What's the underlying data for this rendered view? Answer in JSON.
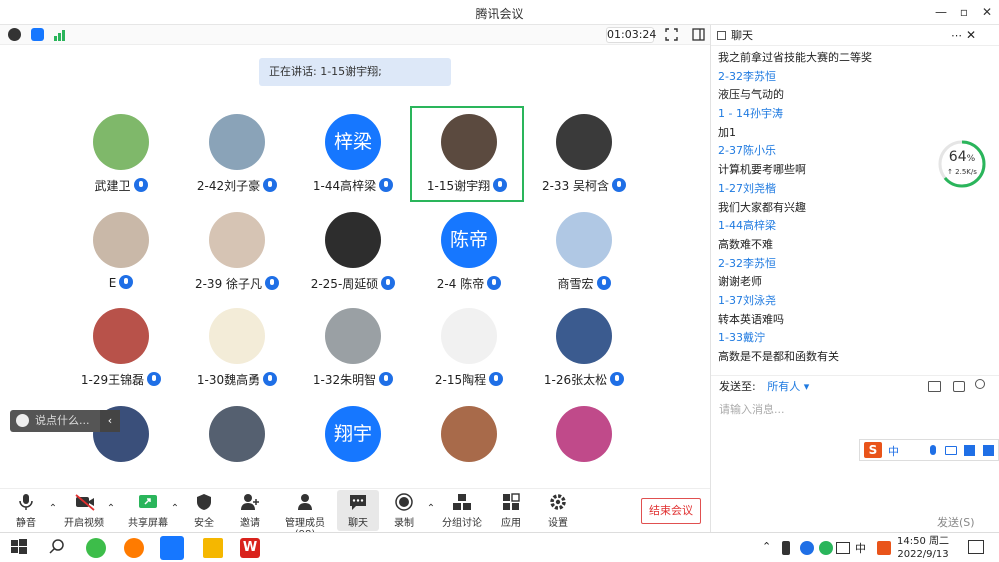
{
  "window": {
    "title": "腾讯会议"
  },
  "topbar": {
    "timer": "01:03:24"
  },
  "main": {
    "speaking": "正在讲话: 1-15谢宇翔;"
  },
  "participants": [
    {
      "name": "武建卫",
      "avatar_text": ""
    },
    {
      "name": "2-42刘子豪",
      "avatar_text": ""
    },
    {
      "name": "1-44高梓梁",
      "avatar_text": "梓梁"
    },
    {
      "name": "1-15谢宇翔",
      "avatar_text": ""
    },
    {
      "name": "2-33 吴柯含",
      "avatar_text": ""
    },
    {
      "name": "E",
      "avatar_text": ""
    },
    {
      "name": "2-39 徐子凡",
      "avatar_text": ""
    },
    {
      "name": "2-25-周延硕",
      "avatar_text": ""
    },
    {
      "name": "2-4 陈帝",
      "avatar_text": "陈帝"
    },
    {
      "name": "商雪宏",
      "avatar_text": ""
    },
    {
      "name": "1-29王锦磊",
      "avatar_text": ""
    },
    {
      "name": "1-30魏高勇",
      "avatar_text": ""
    },
    {
      "name": "1-32朱明智",
      "avatar_text": ""
    },
    {
      "name": "2-15陶程",
      "avatar_text": ""
    },
    {
      "name": "1-26张太松",
      "avatar_text": ""
    },
    {
      "name": "",
      "avatar_text": ""
    },
    {
      "name": "",
      "avatar_text": ""
    },
    {
      "name": "",
      "avatar_text": "翔宇"
    },
    {
      "name": "",
      "avatar_text": ""
    },
    {
      "name": "",
      "avatar_text": ""
    }
  ],
  "say_box": {
    "placeholder": "说点什么..."
  },
  "toolbar": {
    "mute": "静音",
    "video": "开启视频",
    "share": "共享屏幕",
    "security": "安全",
    "invite": "邀请",
    "members": "管理成员(98)",
    "chat": "聊天",
    "record": "录制",
    "breakout": "分组讨论",
    "apps": "应用",
    "settings": "设置",
    "end": "结束会议"
  },
  "chat": {
    "title": "聊天",
    "messages": [
      {
        "text": "我之前拿过省技能大赛的二等奖",
        "kind": "text"
      },
      {
        "text": "2-32李苏恒",
        "kind": "name"
      },
      {
        "text": "液压与气动的",
        "kind": "text"
      },
      {
        "text": "1 - 14孙宇涛",
        "kind": "name"
      },
      {
        "text": "加1",
        "kind": "text"
      },
      {
        "text": "2-37陈小乐",
        "kind": "name"
      },
      {
        "text": "计算机要考哪些啊",
        "kind": "text"
      },
      {
        "text": "1-27刘尧楷",
        "kind": "name"
      },
      {
        "text": "我们大家都有兴趣",
        "kind": "text"
      },
      {
        "text": "1-44高梓梁",
        "kind": "name"
      },
      {
        "text": "高数难不难",
        "kind": "text"
      },
      {
        "text": "2-32李苏恒",
        "kind": "name"
      },
      {
        "text": "谢谢老师",
        "kind": "text"
      },
      {
        "text": "1-37刘泳尧",
        "kind": "name"
      },
      {
        "text": "转本英语难吗",
        "kind": "text"
      },
      {
        "text": "1-33戴泞",
        "kind": "name"
      },
      {
        "text": "高数是不是都和函数有关",
        "kind": "text"
      }
    ],
    "send_to_label": "发送至:",
    "send_to_value": "所有人",
    "input_placeholder": "请输入消息...",
    "send_button": "发送(S)"
  },
  "network": {
    "percent": "64",
    "unit": "%",
    "speed": "2.5K/s"
  },
  "taskbar": {
    "time": "14:50 周二",
    "date": "2022/9/13",
    "ime": "中"
  },
  "colors": {
    "accent": "#1677ff",
    "speaking_frame": "#2ab55b",
    "end": "#e03030"
  }
}
